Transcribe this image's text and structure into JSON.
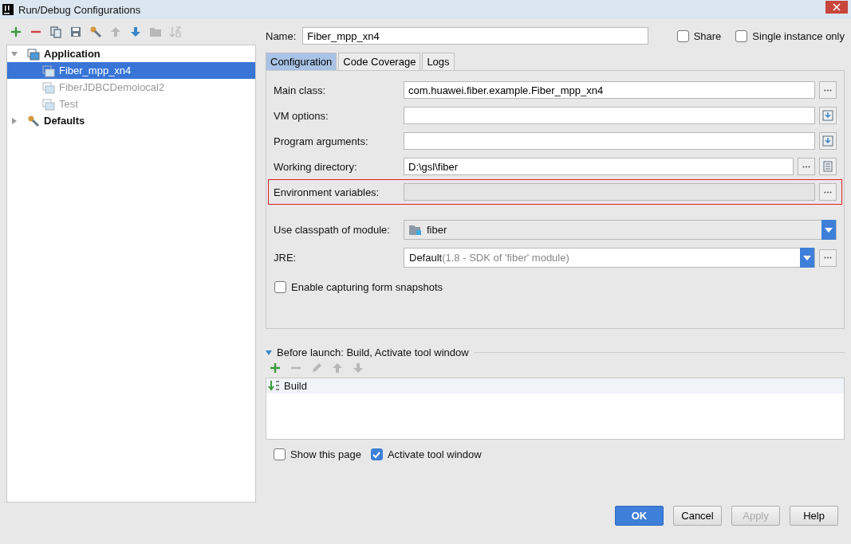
{
  "window": {
    "title": "Run/Debug Configurations"
  },
  "toolbar": [
    {
      "disabled": false
    },
    {
      "disabled": false
    },
    {
      "disabled": false
    },
    {
      "disabled": false
    },
    {
      "disabled": false
    },
    {
      "disabled": true
    },
    {
      "disabled": false
    },
    {
      "disabled": true
    },
    {
      "disabled": true
    }
  ],
  "tree": [
    {
      "label": "Application",
      "expanded": true,
      "selected": false,
      "dimmed": false,
      "children": [
        {
          "label": "Fiber_mpp_xn4",
          "selected": true,
          "dimmed": false
        },
        {
          "label": "FiberJDBCDemolocal2",
          "selected": false,
          "dimmed": true
        },
        {
          "label": "Test",
          "selected": false,
          "dimmed": true
        }
      ]
    },
    {
      "label": "Defaults",
      "expanded": false,
      "selected": false,
      "dimmed": false
    }
  ],
  "name": {
    "label": "Name:",
    "value": "Fiber_mpp_xn4"
  },
  "options": [
    {
      "label": "Share",
      "checked": false
    },
    {
      "label": "Single instance only",
      "checked": false
    }
  ],
  "tabs": [
    {
      "label": "Configuration",
      "selected": true
    },
    {
      "label": "Code Coverage",
      "selected": false
    },
    {
      "label": "Logs",
      "selected": false
    }
  ],
  "fields": [
    {
      "label": "Main class:",
      "value": "com.huawei.fiber.example.Fiber_mpp_xn4",
      "disabled": false,
      "highlighted": false
    },
    {
      "label": "VM options:",
      "disabled": false,
      "highlighted": false
    },
    {
      "label": "Program arguments:",
      "disabled": false,
      "highlighted": false
    },
    {
      "label": "Working directory:",
      "value": "D:\\gsl\\fiber",
      "disabled": false,
      "highlighted": false
    },
    {
      "label": "Environment variables:",
      "disabled": true,
      "highlighted": true
    }
  ],
  "selects": [
    {
      "label": "Use classpath of module:",
      "value": "fiber"
    },
    {
      "label": "JRE:",
      "value": "Default",
      "hint": "(1.8 - SDK of 'fiber' module)"
    }
  ],
  "snapshots": {
    "label": "Enable capturing form snapshots",
    "checked": false
  },
  "before_launch": {
    "title": "Before launch: Build, Activate tool window",
    "expanded": true,
    "toolbar": [
      {
        "disabled": false
      },
      {
        "disabled": true
      },
      {
        "disabled": true
      },
      {
        "disabled": true
      },
      {
        "disabled": true
      }
    ],
    "tasks": [
      {
        "label": "Build",
        "selected": true
      }
    ]
  },
  "launch_options": [
    {
      "label": "Show this page",
      "checked": false
    },
    {
      "label": "Activate tool window",
      "checked": true
    }
  ],
  "buttons": [
    {
      "label": "OK",
      "kind": "primary",
      "disabled": false
    },
    {
      "label": "Cancel",
      "kind": "normal",
      "disabled": false
    },
    {
      "label": "Apply",
      "kind": "normal",
      "disabled": true
    },
    {
      "label": "Help",
      "kind": "normal",
      "disabled": false
    }
  ]
}
